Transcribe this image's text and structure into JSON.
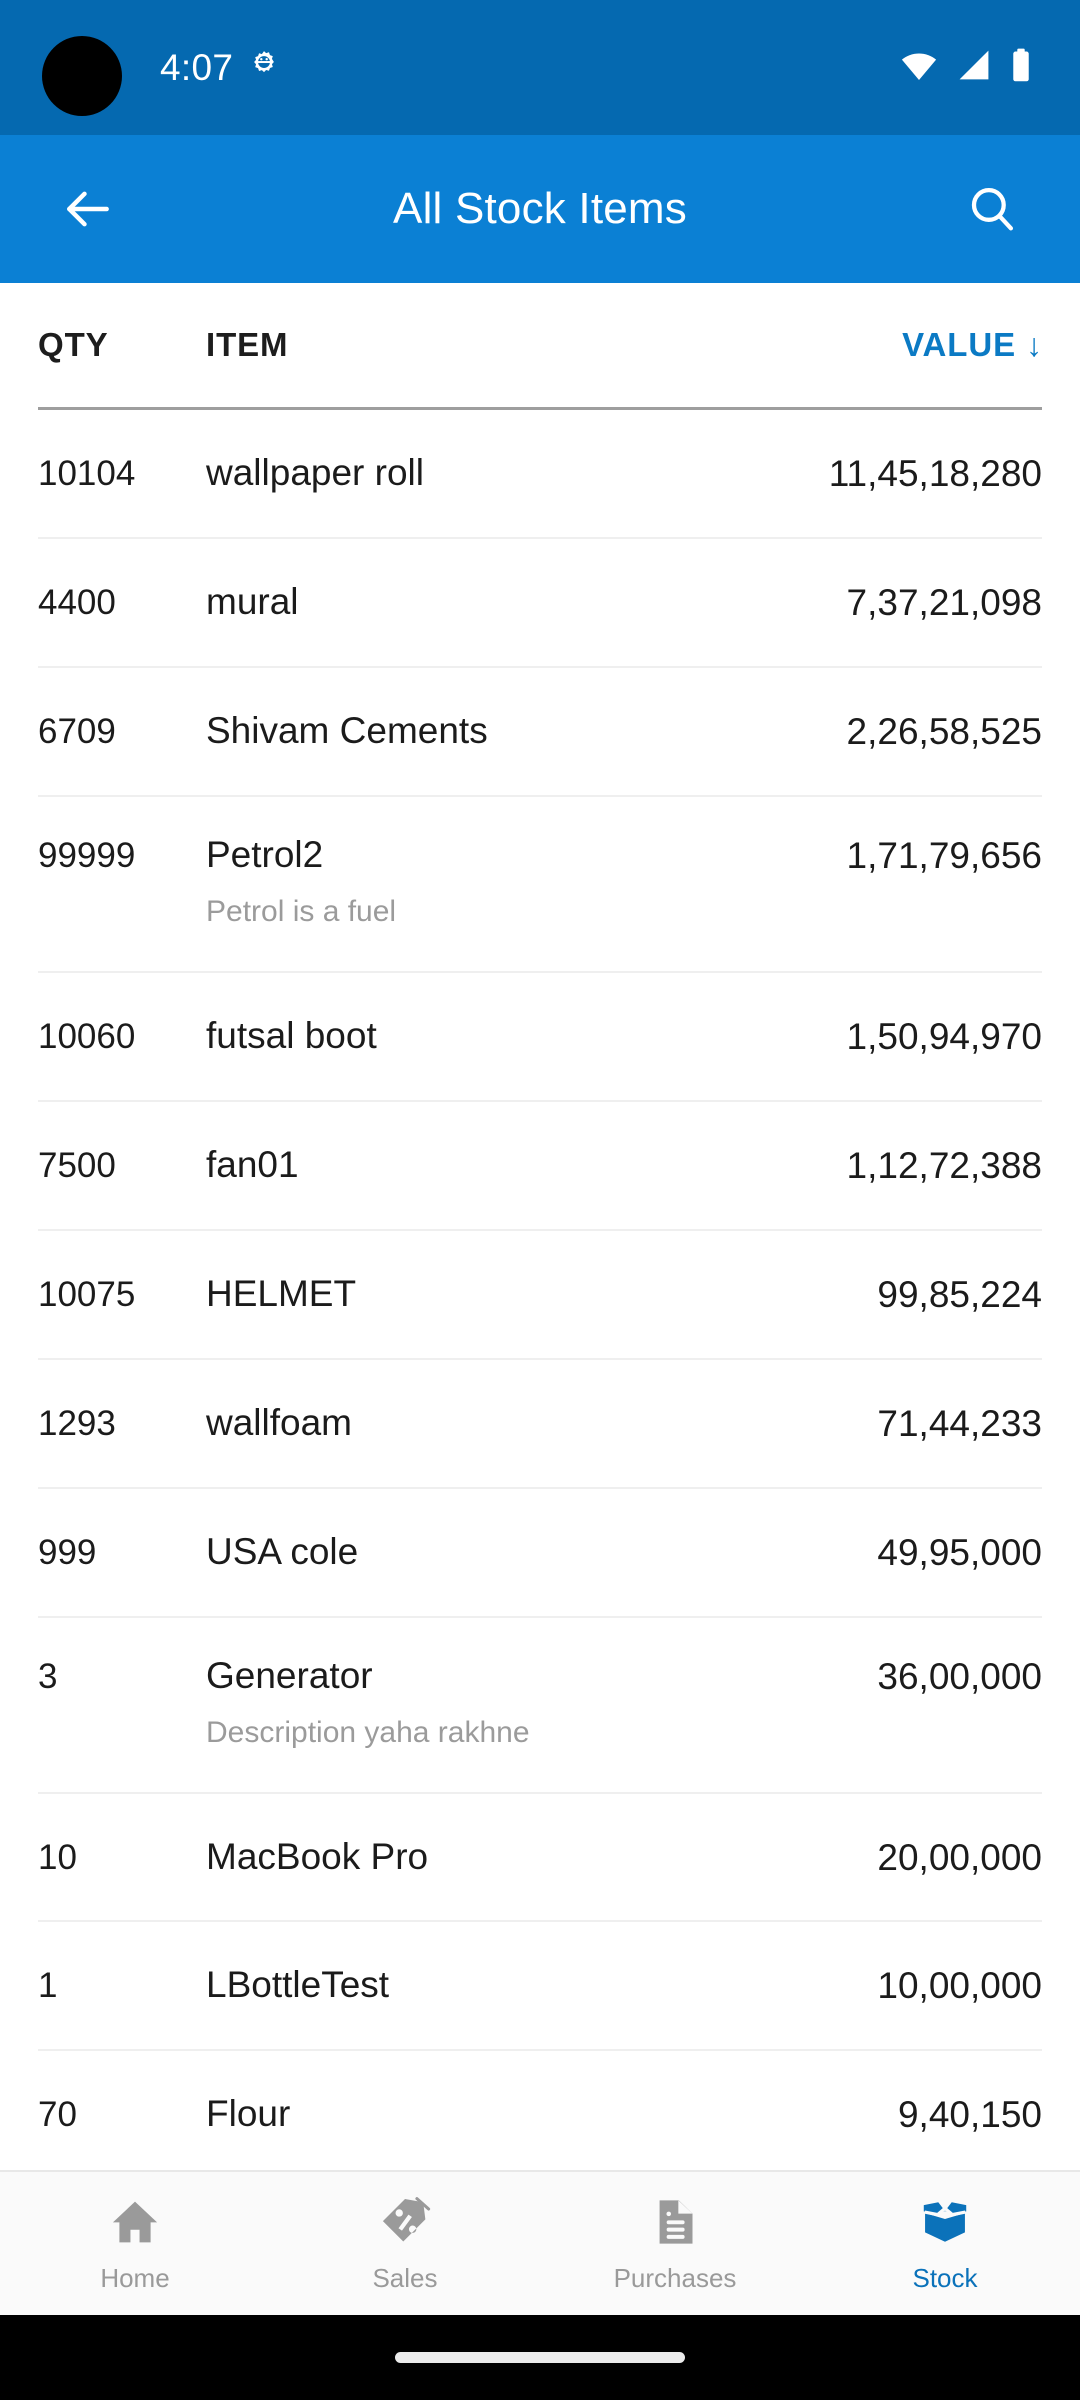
{
  "status_bar": {
    "time": "4:07",
    "icons": [
      "gear-icon",
      "wifi-icon",
      "cellular-signal-icon",
      "battery-icon"
    ],
    "background": "#0569b0"
  },
  "app_bar": {
    "title": "All Stock Items",
    "back_icon": "arrow-left-icon",
    "search_icon": "search-icon",
    "background": "#0b80d4"
  },
  "table": {
    "columns": {
      "qty": "QTY",
      "item": "ITEM",
      "value": "VALUE"
    },
    "sort": {
      "column": "VALUE",
      "direction": "descending",
      "arrow": "↓",
      "color": "#0b7ac4"
    },
    "rows": [
      {
        "qty": "10104",
        "item": "wallpaper roll",
        "description": "",
        "value": "11,45,18,280"
      },
      {
        "qty": "4400",
        "item": "mural",
        "description": "",
        "value": "7,37,21,098"
      },
      {
        "qty": "6709",
        "item": "Shivam Cements",
        "description": "",
        "value": "2,26,58,525"
      },
      {
        "qty": "99999",
        "item": "Petrol2",
        "description": "Petrol is a fuel",
        "value": "1,71,79,656"
      },
      {
        "qty": "10060",
        "item": "futsal boot",
        "description": "",
        "value": "1,50,94,970"
      },
      {
        "qty": "7500",
        "item": "fan01",
        "description": "",
        "value": "1,12,72,388"
      },
      {
        "qty": "10075",
        "item": "HELMET",
        "description": "",
        "value": "99,85,224"
      },
      {
        "qty": "1293",
        "item": "wallfoam",
        "description": "",
        "value": "71,44,233"
      },
      {
        "qty": "999",
        "item": "USA cole",
        "description": "",
        "value": "49,95,000"
      },
      {
        "qty": "3",
        "item": "Generator",
        "description": "Description yaha rakhne",
        "value": "36,00,000"
      },
      {
        "qty": "10",
        "item": "MacBook Pro",
        "description": "",
        "value": "20,00,000"
      },
      {
        "qty": "1",
        "item": "LBottleTest",
        "description": "",
        "value": "10,00,000"
      },
      {
        "qty": "70",
        "item": "Flour",
        "description": "",
        "value": "9,40,150"
      }
    ]
  },
  "bottom_nav": {
    "active_index": 3,
    "active_color": "#0b72ba",
    "inactive_color": "#9a9a9a",
    "items": [
      {
        "label": "Home",
        "icon": "home-icon"
      },
      {
        "label": "Sales",
        "icon": "price-tag-icon"
      },
      {
        "label": "Purchases",
        "icon": "document-icon"
      },
      {
        "label": "Stock",
        "icon": "open-box-icon"
      }
    ]
  }
}
